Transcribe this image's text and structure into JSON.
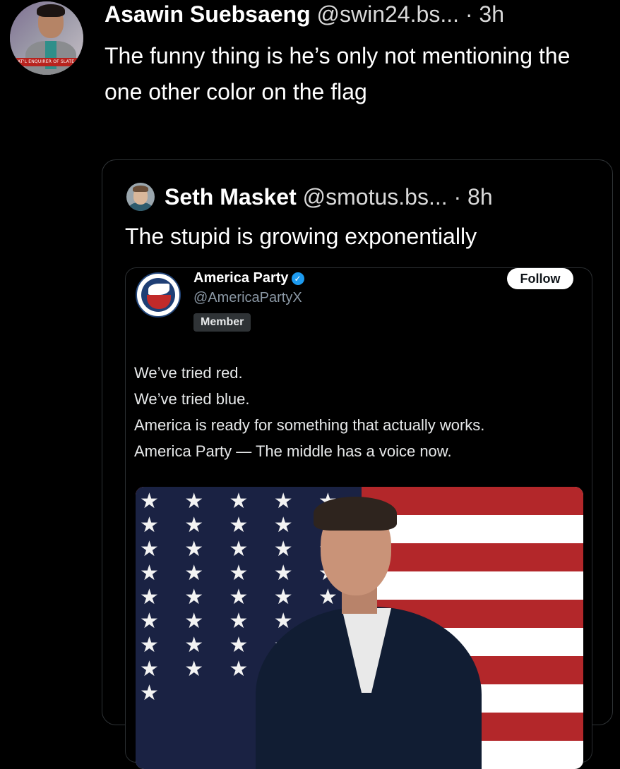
{
  "outer_post": {
    "author_name": "Asawin Suebsaeng",
    "handle": "@swin24.bs...",
    "separator": "·",
    "time": "3h",
    "text": "The funny thing is he’s only not mentioning the one other color on the flag",
    "avatar_ticker": "...NAT'L ENQUIRER OF SLATE"
  },
  "quoted_post": {
    "author_name": "Seth Masket",
    "handle": "@smotus.bs...",
    "separator": "·",
    "time": "8h",
    "text": "The stupid is growing exponentially"
  },
  "embedded_post": {
    "account_name": "America Party",
    "verified_mark": "✓",
    "handle": "@AmericaPartyX",
    "badge": "Member",
    "follow_label": "Follow",
    "lines": [
      "We’ve tried red.",
      "We’ve tried blue.",
      "America is ready for something that actually works.",
      "America Party — The middle has a voice now."
    ],
    "stars": "★ ★ ★ ★ ★ ★ ★ ★ ★ ★ ★ ★ ★ ★ ★ ★ ★ ★ ★ ★ ★ ★ ★ ★ ★ ★ ★ ★ ★ ★ ★ ★ ★ ★ ★ ★ ★ ★ ★ ★ ★"
  },
  "colors": {
    "background": "#000000",
    "text": "#ffffff",
    "muted": "#d9d9d9",
    "verified": "#1d9bf0",
    "border": "#2f3336"
  }
}
